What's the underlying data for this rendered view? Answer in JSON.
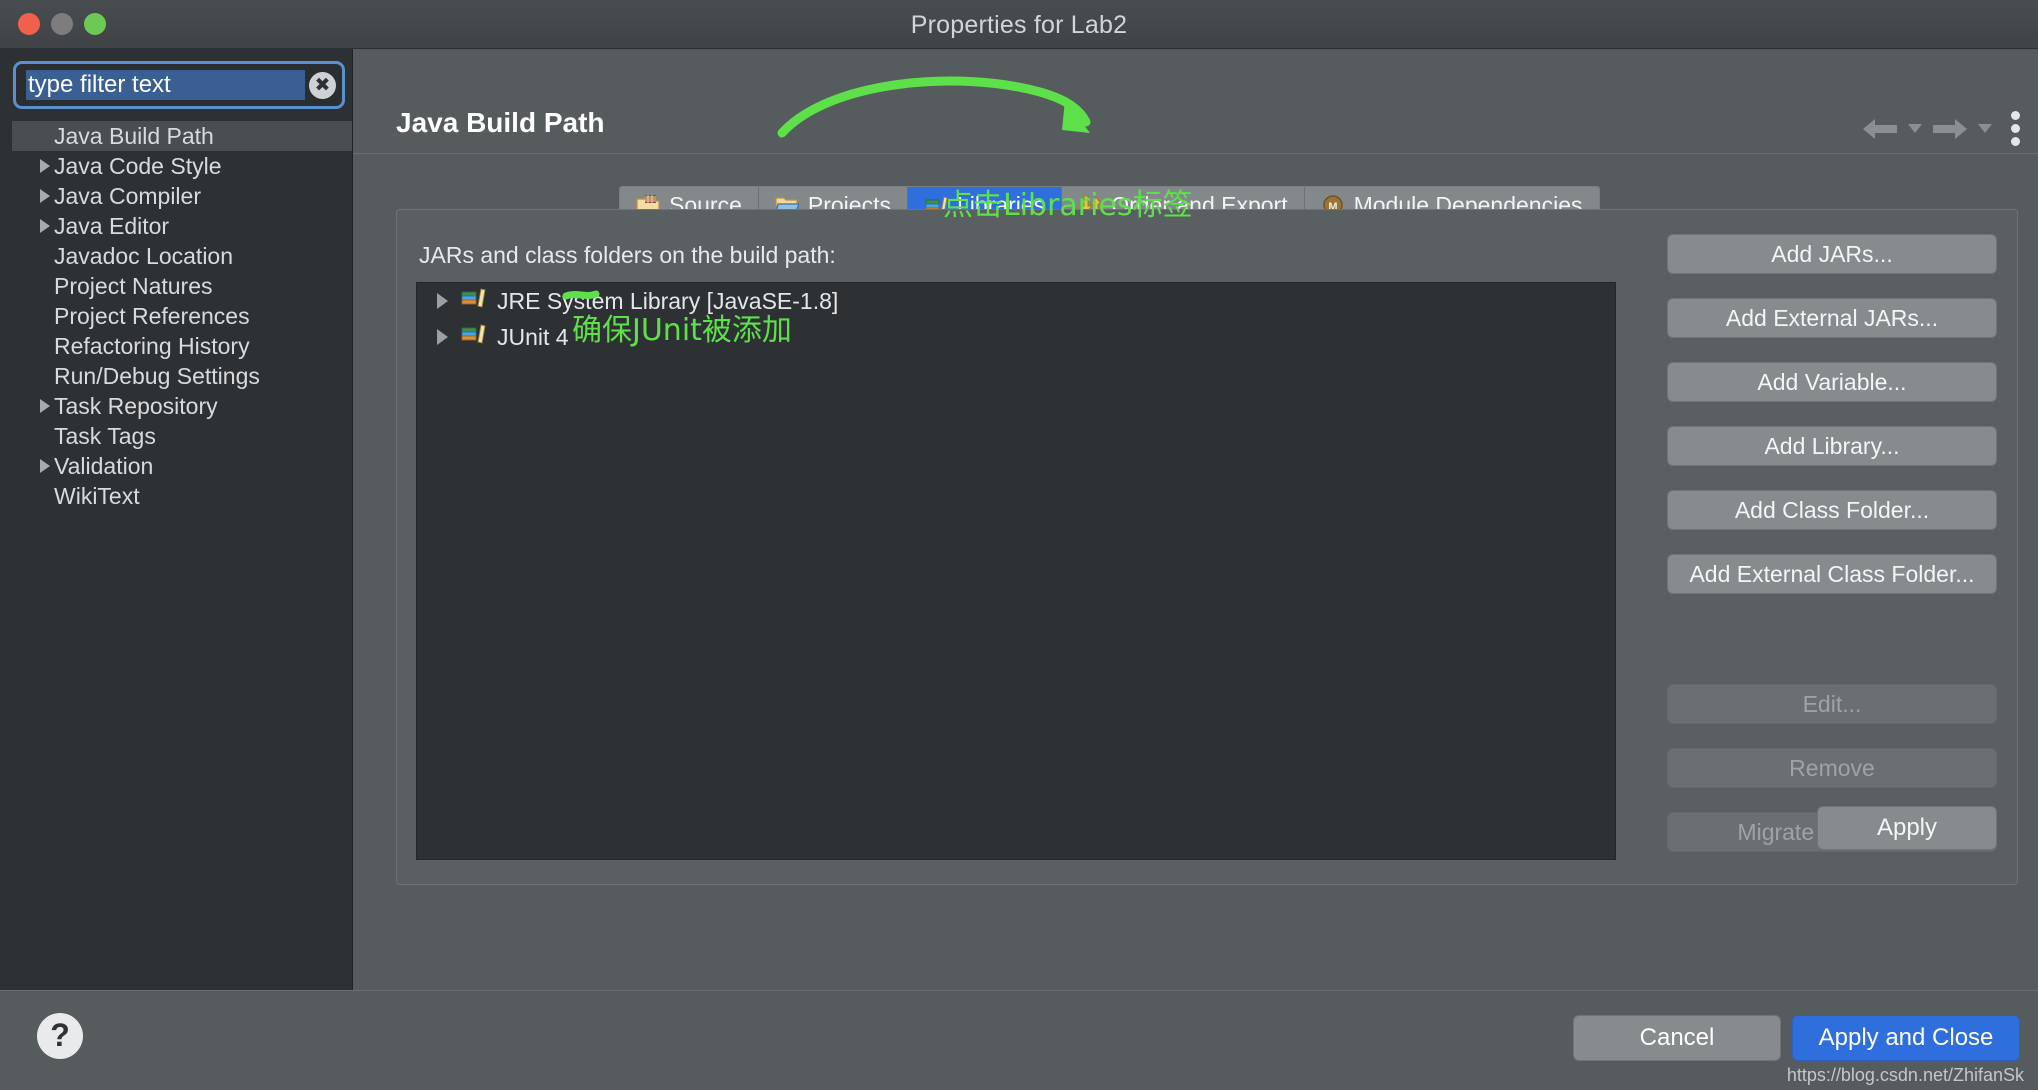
{
  "window": {
    "title": "Properties for Lab2",
    "traffic_lights": [
      "close",
      "minimize",
      "zoom"
    ]
  },
  "sidebar": {
    "filter": {
      "value": "type filter text",
      "placeholder": "type filter text",
      "clear_icon": "clear-circle-icon"
    },
    "items": [
      {
        "label": "Java Build Path",
        "expandable": false,
        "selected": true
      },
      {
        "label": "Java Code Style",
        "expandable": true,
        "selected": false
      },
      {
        "label": "Java Compiler",
        "expandable": true,
        "selected": false
      },
      {
        "label": "Java Editor",
        "expandable": true,
        "selected": false
      },
      {
        "label": "Javadoc Location",
        "expandable": false,
        "selected": false
      },
      {
        "label": "Project Natures",
        "expandable": false,
        "selected": false
      },
      {
        "label": "Project References",
        "expandable": false,
        "selected": false
      },
      {
        "label": "Refactoring History",
        "expandable": false,
        "selected": false
      },
      {
        "label": "Run/Debug Settings",
        "expandable": false,
        "selected": false
      },
      {
        "label": "Task Repository",
        "expandable": true,
        "selected": false
      },
      {
        "label": "Task Tags",
        "expandable": false,
        "selected": false
      },
      {
        "label": "Validation",
        "expandable": true,
        "selected": false
      },
      {
        "label": "WikiText",
        "expandable": false,
        "selected": false
      }
    ]
  },
  "header": {
    "page_title": "Java Build Path",
    "nav": {
      "back_icon": "back-arrow-icon",
      "back_caret_icon": "chevron-down-icon",
      "forward_icon": "forward-arrow-icon",
      "forward_caret_icon": "chevron-down-icon",
      "menu_icon": "vertical-dots-menu-icon"
    }
  },
  "tabs": [
    {
      "label": "Source",
      "icon": "source-folder-icon",
      "active": false
    },
    {
      "label": "Projects",
      "icon": "projects-folder-icon",
      "active": false
    },
    {
      "label": "Libraries",
      "icon": "libraries-books-icon",
      "active": true
    },
    {
      "label": "Order and Export",
      "icon": "order-export-arrows-icon",
      "active": false
    },
    {
      "label": "Module Dependencies",
      "icon": "module-m-badge-icon",
      "active": false
    }
  ],
  "panel": {
    "label": "JARs and class folders on the build path:",
    "entries": [
      {
        "label": "JRE System Library [JavaSE-1.8]",
        "icon": "libraries-books-icon",
        "expandable": true
      },
      {
        "label": "JUnit 4",
        "icon": "libraries-books-icon",
        "expandable": true
      }
    ],
    "buttons": [
      {
        "label": "Add JARs...",
        "disabled": false
      },
      {
        "label": "Add External JARs...",
        "disabled": false
      },
      {
        "label": "Add Variable...",
        "disabled": false
      },
      {
        "label": "Add Library...",
        "disabled": false
      },
      {
        "label": "Add Class Folder...",
        "disabled": false
      },
      {
        "label": "Add External Class Folder...",
        "disabled": false
      },
      {
        "label": "Edit...",
        "disabled": true
      },
      {
        "label": "Remove",
        "disabled": true
      },
      {
        "label": "Migrate JAR File...",
        "disabled": true
      }
    ],
    "apply_label": "Apply"
  },
  "footer": {
    "help_icon": "help-question-icon",
    "cancel_label": "Cancel",
    "apply_and_close_label": "Apply and Close",
    "watermark": "https://blog.csdn.net/ZhifanSk"
  },
  "annotations": [
    {
      "id": "anno-libraries",
      "text": "点击Libraries标签"
    },
    {
      "id": "anno-junit",
      "text": "确保JUnit被添加"
    }
  ],
  "colors": {
    "accent_blue": "#2f6fdd",
    "annotation_green": "#5ee04a",
    "window_bg": "#565b5e",
    "sidebar_bg": "#2e3133",
    "list_bg": "#2e3133"
  }
}
